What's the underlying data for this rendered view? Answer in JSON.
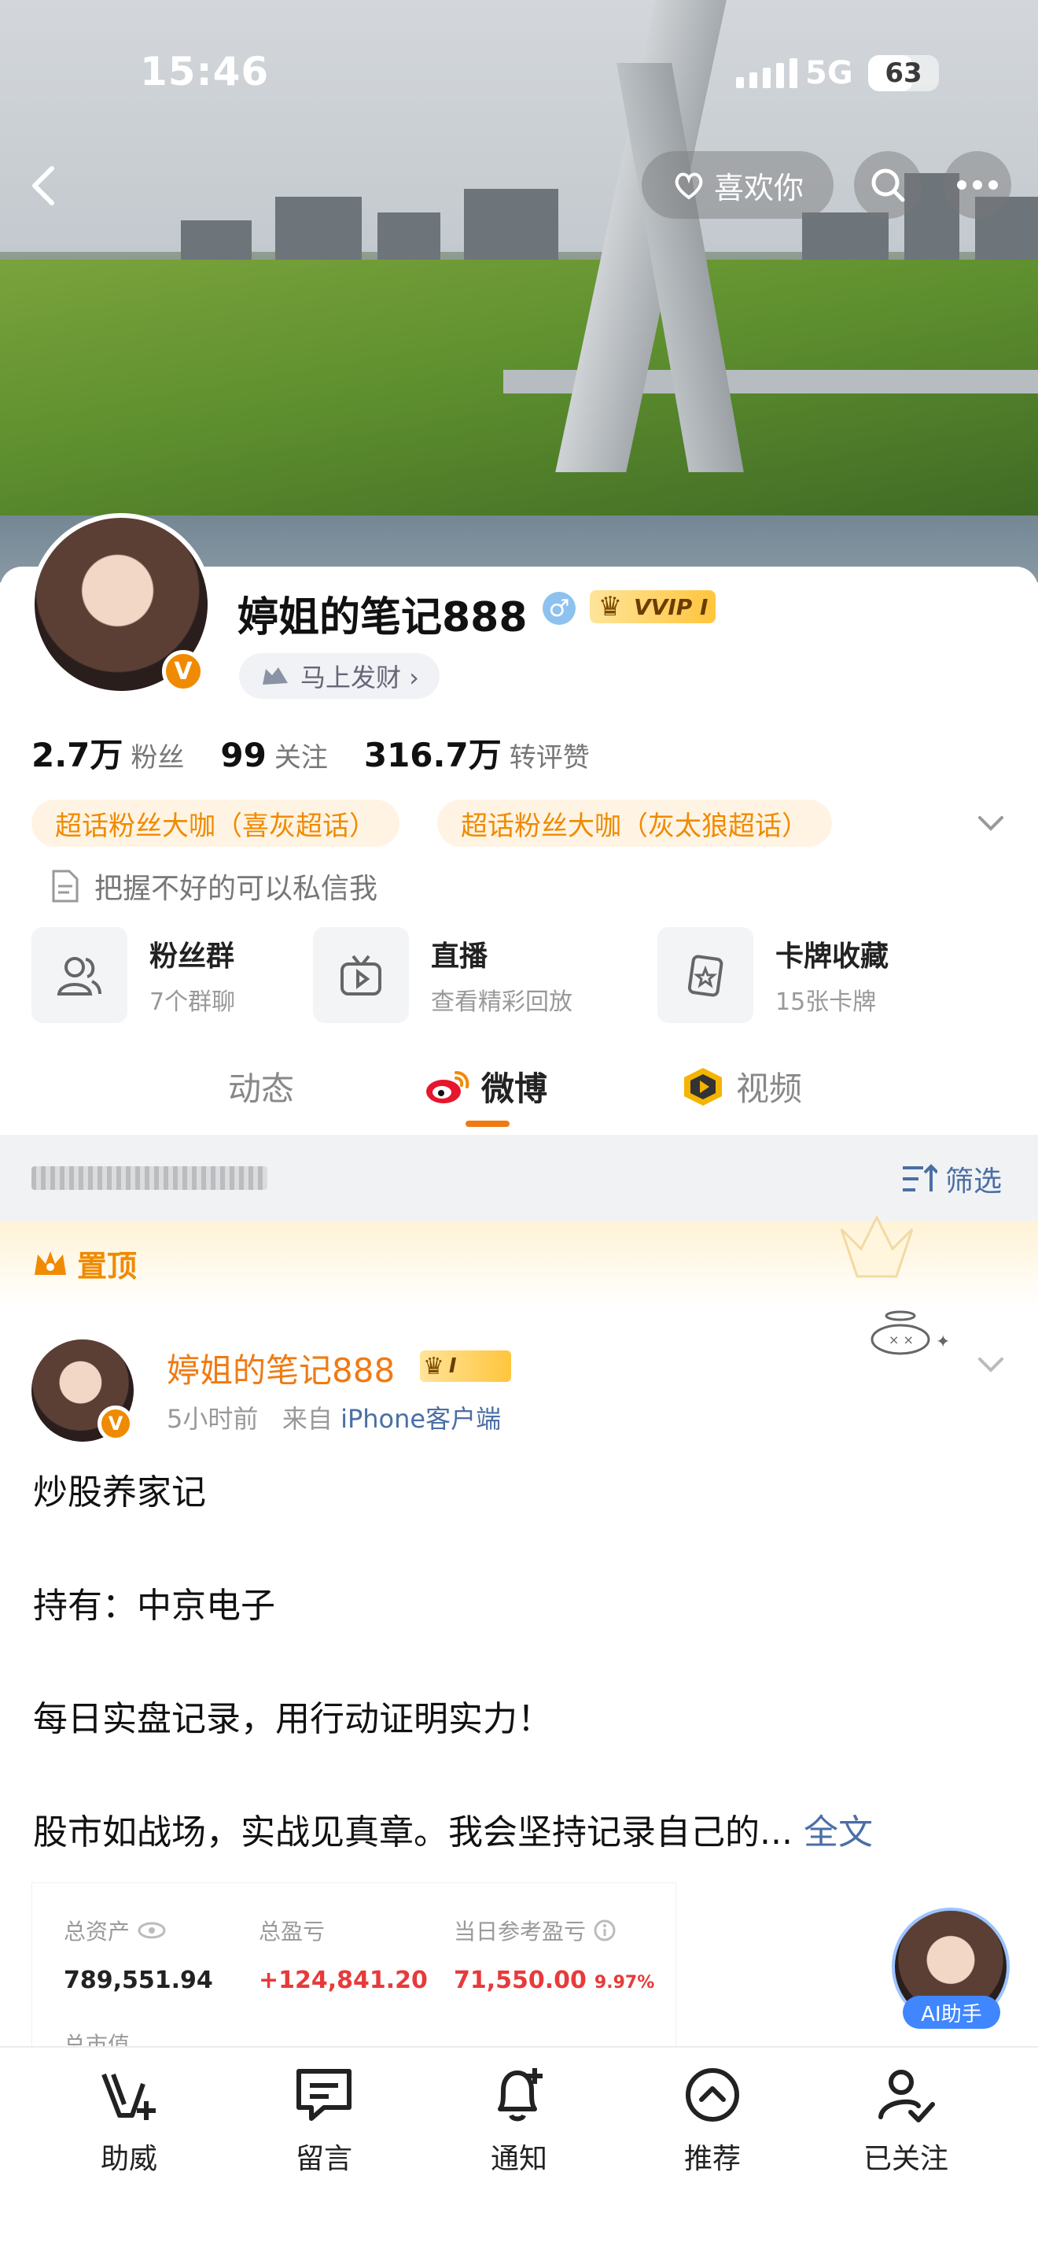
{
  "status_bar": {
    "time": "15:46",
    "network": "5G",
    "battery": "63",
    "battery_level": 0.63
  },
  "header": {
    "like_label": "喜欢你"
  },
  "profile": {
    "name": "婷姐的笔记888",
    "vip_label": "VVIP I",
    "tag_label": "马上发财 ›",
    "stats": [
      {
        "value": "2.7万",
        "label": "粉丝"
      },
      {
        "value": "99",
        "label": "关注"
      },
      {
        "value": "316.7万",
        "label": "转评赞"
      }
    ],
    "super_topics": [
      "超话粉丝大咖（喜灰超话）",
      "超话粉丝大咖（灰太狼超话）"
    ],
    "bio": "把握不好的可以私信我",
    "features": [
      {
        "title": "粉丝群",
        "subtitle": "7个群聊",
        "icon": "fans-group-icon"
      },
      {
        "title": "直播",
        "subtitle": "查看精彩回放",
        "icon": "live-tv-icon"
      },
      {
        "title": "卡牌收藏",
        "subtitle": "15张卡牌",
        "icon": "card-collection-icon"
      }
    ]
  },
  "tabs": [
    {
      "label": "动态"
    },
    {
      "label": "微博"
    },
    {
      "label": "视频"
    }
  ],
  "filter": {
    "label": "筛选"
  },
  "pinned": {
    "label": "置顶"
  },
  "post": {
    "author": "婷姐的笔记888",
    "vip_label": "I",
    "time": "5小时前",
    "from_prefix": "来自",
    "source": "iPhone客户端",
    "lines": [
      "炒股养家记",
      "持有：中京电子",
      "每日实盘记录，用行动证明实力！",
      "股市如战场，实战见真章。我会坚持记录自己的..."
    ],
    "full_text_link": "全文",
    "assets": {
      "total_assets_label": "总资产",
      "total_assets_value": "789,551.94",
      "total_pnl_label": "总盈亏",
      "total_pnl_value": "+124,841.20",
      "daily_pnl_label": "当日参考盈亏",
      "daily_pnl_value": "71,550.00",
      "daily_pnl_pct": "9.97%",
      "row2_label": "总市值"
    }
  },
  "ai_helper": {
    "label": "AI助手"
  },
  "bottom_bar": [
    {
      "label": "助威",
      "icon": "v-plus-icon"
    },
    {
      "label": "留言",
      "icon": "message-icon"
    },
    {
      "label": "通知",
      "icon": "bell-plus-icon"
    },
    {
      "label": "推荐",
      "icon": "recommend-up-icon"
    },
    {
      "label": "已关注",
      "icon": "user-check-icon"
    }
  ],
  "colors": {
    "accent_orange": "#f07a12",
    "link_blue": "#4a6fa5",
    "pnl_red": "#e83a3a"
  }
}
